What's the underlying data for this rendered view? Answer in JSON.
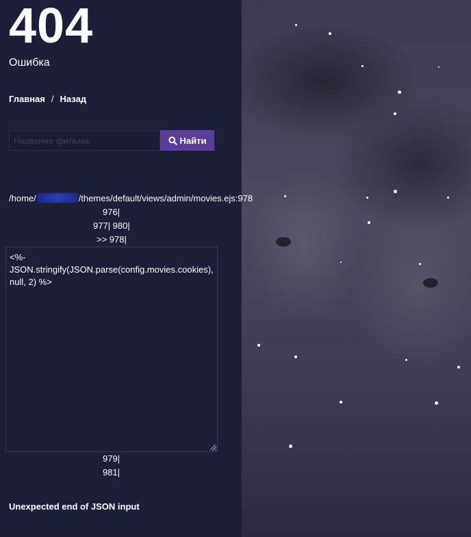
{
  "error": {
    "code": "404",
    "title": "Ошибка"
  },
  "breadcrumbs": {
    "home": "Главная",
    "separator": "/",
    "back": "Назад"
  },
  "search": {
    "placeholder": "Название фильма",
    "value": "",
    "button_label": "Найти",
    "button_color": "#5a3f99"
  },
  "trace": {
    "path_prefix": "/home/",
    "path_suffix": "/themes/default/views/admin/movies.ejs:978",
    "line_976": "976|",
    "line_977_980": "977| 980|",
    "line_978": ">> 978|",
    "code": "<%-\nJSON.stringify(JSON.parse(config.movies.cookies), null, 2) %>",
    "line_979": "979|",
    "line_981": "981|"
  },
  "message": "Unexpected end of JSON input",
  "colors": {
    "background": "#1d1e37",
    "accent": "#5a3f99"
  }
}
